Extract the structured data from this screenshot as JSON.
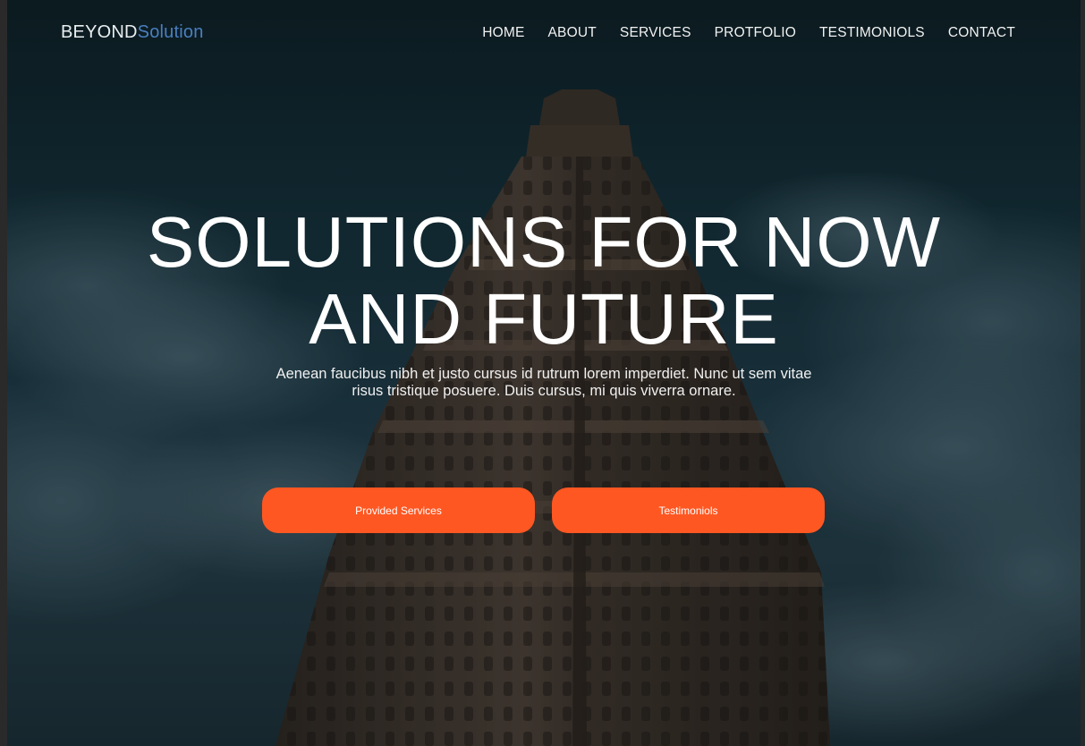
{
  "brand": {
    "part1": "BEYOND",
    "part2": "Solution"
  },
  "nav": {
    "items": [
      {
        "label": "HOME"
      },
      {
        "label": "ABOUT"
      },
      {
        "label": "SERVICES"
      },
      {
        "label": "PROTFOLIO"
      },
      {
        "label": "TESTIMONIOLS"
      },
      {
        "label": "CONTACT"
      }
    ]
  },
  "hero": {
    "headline_line1": "SOLUTIONS FOR NOW",
    "headline_line2": "AND FUTURE",
    "subtitle_line1": "Aenean faucibus nibh et justo cursus id rutrum lorem imperdiet. Nunc ut sem vitae",
    "subtitle_line2": "risus tristique posuere. Duis cursus, mi quis viverra ornare.",
    "buttons": {
      "services": "Provided Services",
      "testimonials": "Testimoniols"
    }
  },
  "colors": {
    "accent": "#ff5722",
    "brand_highlight": "#4a7fc0",
    "text": "#ffffff"
  }
}
